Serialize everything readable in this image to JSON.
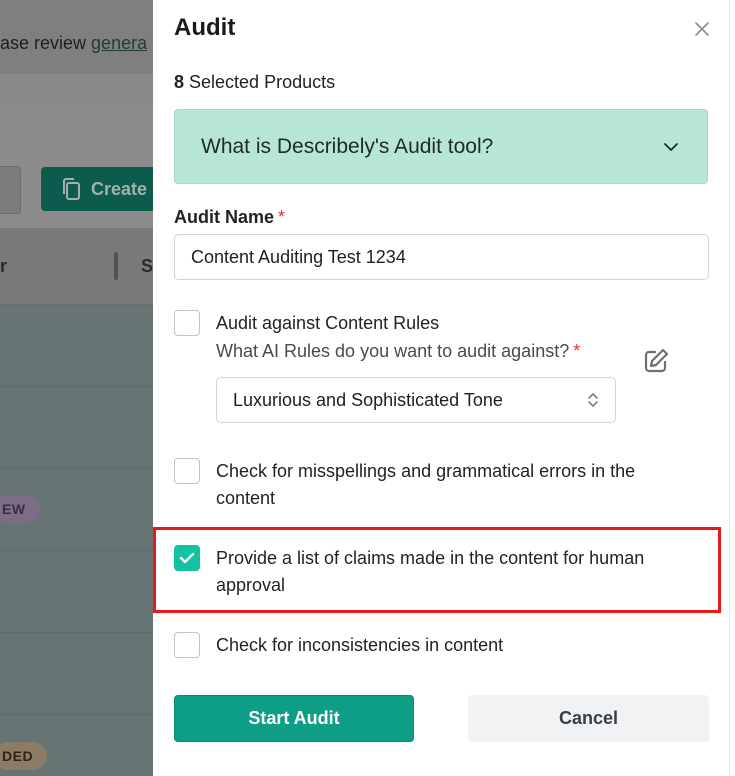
{
  "background": {
    "notice_text": "ase review ",
    "notice_link": "genera",
    "create_button_label": "Create",
    "column_partial_r": "r",
    "column_s": "S",
    "badge_new": "EW",
    "badge_ded": "DED"
  },
  "modal": {
    "title": "Audit",
    "selected_count": "8",
    "selected_label": " Selected Products",
    "accordion_label": "What is Describely's Audit tool?",
    "audit_name_label": "Audit Name",
    "required_mark": "*",
    "audit_name_value": "Content Auditing Test 1234",
    "options": [
      {
        "label": "Audit against Content Rules",
        "checked": false
      },
      {
        "label": "Check for misspellings and grammatical errors in the content",
        "checked": false
      },
      {
        "label": "Provide a list of claims made in the content for human approval",
        "checked": true
      },
      {
        "label": "Check for inconsistencies in content",
        "checked": false
      }
    ],
    "rules_question": "What AI Rules do you want to audit against?",
    "rules_selected": "Luxurious and Sophisticated Tone",
    "start_button": "Start Audit",
    "cancel_button": "Cancel"
  },
  "colors": {
    "accent": "#12c2a3",
    "primary_button": "#0e9e86",
    "accordion_bg": "#b7e6d9",
    "highlight": "#e41b1b",
    "required": "#e0342b"
  }
}
